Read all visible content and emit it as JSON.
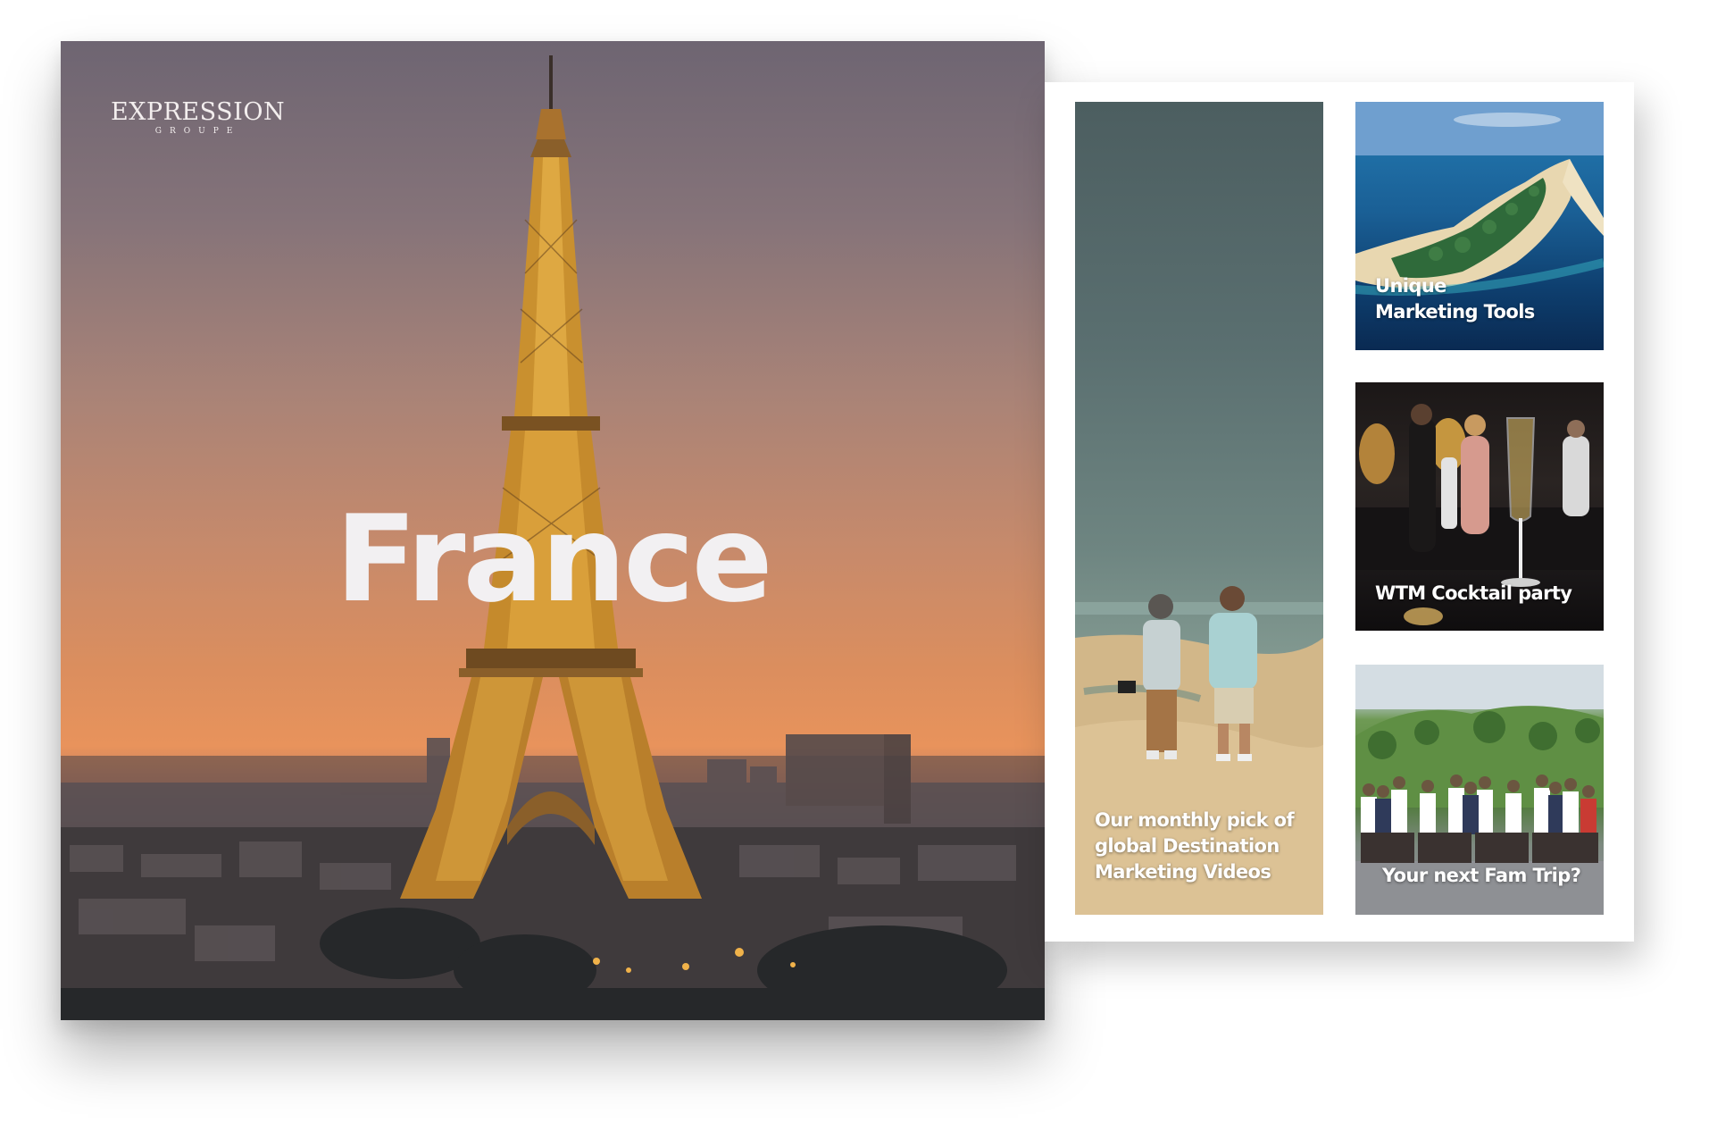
{
  "hero": {
    "logo_word": "EXPRESSION",
    "logo_sub": "GROUPE",
    "title": "France"
  },
  "tiles": {
    "videos": {
      "caption_lines": [
        "Our monthly pick of",
        "global Destination",
        "Marketing Videos"
      ]
    },
    "tools": {
      "caption_lines": [
        "Unique",
        "Marketing Tools"
      ]
    },
    "party": {
      "caption_lines": [
        "WTM Cocktail party"
      ]
    },
    "fam": {
      "caption_lines": [
        "Your next Fam Trip?"
      ]
    }
  },
  "colors": {
    "sky_top": "#6e6572",
    "sky_sunset": "#e8935c",
    "tower_gold": "#c9902f",
    "panel_bg": "#ffffff"
  }
}
